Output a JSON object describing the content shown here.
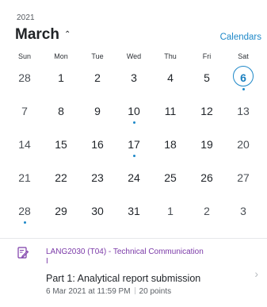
{
  "header": {
    "year": "2021",
    "month": "March",
    "month_chevron": "^",
    "calendars_link": "Calendars"
  },
  "weekdays": [
    "Sun",
    "Mon",
    "Tue",
    "Wed",
    "Thu",
    "Fri",
    "Sat"
  ],
  "weeks": [
    [
      {
        "label": "28",
        "state": "out",
        "dot": false
      },
      {
        "label": "1",
        "state": "in",
        "dot": false
      },
      {
        "label": "2",
        "state": "in",
        "dot": false
      },
      {
        "label": "3",
        "state": "in",
        "dot": false
      },
      {
        "label": "4",
        "state": "in",
        "dot": false
      },
      {
        "label": "5",
        "state": "in",
        "dot": false
      },
      {
        "label": "6",
        "state": "today",
        "dot": true
      }
    ],
    [
      {
        "label": "7",
        "state": "in",
        "dot": false
      },
      {
        "label": "8",
        "state": "in",
        "dot": false
      },
      {
        "label": "9",
        "state": "in",
        "dot": false
      },
      {
        "label": "10",
        "state": "in",
        "dot": true
      },
      {
        "label": "11",
        "state": "in",
        "dot": false
      },
      {
        "label": "12",
        "state": "in",
        "dot": false
      },
      {
        "label": "13",
        "state": "in",
        "dot": false
      }
    ],
    [
      {
        "label": "14",
        "state": "in",
        "dot": false
      },
      {
        "label": "15",
        "state": "in",
        "dot": false
      },
      {
        "label": "16",
        "state": "in",
        "dot": false
      },
      {
        "label": "17",
        "state": "in",
        "dot": true
      },
      {
        "label": "18",
        "state": "in",
        "dot": false
      },
      {
        "label": "19",
        "state": "in",
        "dot": false
      },
      {
        "label": "20",
        "state": "in",
        "dot": false
      }
    ],
    [
      {
        "label": "21",
        "state": "in",
        "dot": false
      },
      {
        "label": "22",
        "state": "in",
        "dot": false
      },
      {
        "label": "23",
        "state": "in",
        "dot": false
      },
      {
        "label": "24",
        "state": "in",
        "dot": false
      },
      {
        "label": "25",
        "state": "in",
        "dot": false
      },
      {
        "label": "26",
        "state": "in",
        "dot": false
      },
      {
        "label": "27",
        "state": "in",
        "dot": false
      }
    ],
    [
      {
        "label": "28",
        "state": "in",
        "dot": true
      },
      {
        "label": "29",
        "state": "in",
        "dot": false
      },
      {
        "label": "30",
        "state": "in",
        "dot": false
      },
      {
        "label": "31",
        "state": "in",
        "dot": false
      },
      {
        "label": "1",
        "state": "out",
        "dot": false
      },
      {
        "label": "2",
        "state": "out",
        "dot": false
      },
      {
        "label": "3",
        "state": "out",
        "dot": false
      }
    ]
  ],
  "event": {
    "icon": "assignment-edit-icon",
    "course": "LANG2030 (T04) - Technical Communication I",
    "title": "Part 1: Analytical report submission",
    "due": "6 Mar 2021 at 11:59 PM",
    "points": "20 points"
  },
  "colors": {
    "accent": "#1e88c8",
    "course": "#7b3aa8"
  }
}
